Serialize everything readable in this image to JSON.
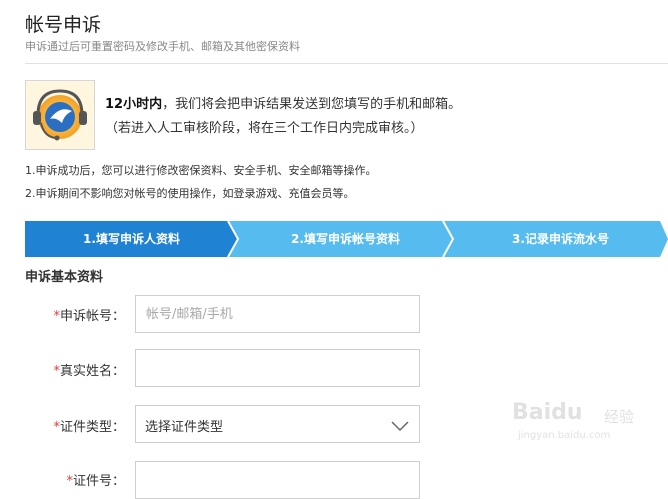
{
  "header": {
    "title": "帐号申诉",
    "subtitle": "申诉通过后可重置密码及修改手机、邮箱及其他密保资料"
  },
  "notice": {
    "emphasis": "12小时内",
    "line1_rest": "，我们将会把申诉结果发送到您填写的手机和邮箱。",
    "line2": "（若进入人工审核阶段，将在三个工作日内完成审核。）",
    "icon": "headset-support-icon"
  },
  "notes": [
    "1.申诉成功后，您可以进行修改密保资料、安全手机、安全邮箱等操作。",
    "2.申诉期间不影响您对帐号的使用操作，如登录游戏、充值会员等。"
  ],
  "steps": [
    {
      "label": "1.填写申诉人资料",
      "active": true
    },
    {
      "label": "2.填写申诉帐号资料",
      "active": false
    },
    {
      "label": "3.记录申诉流水号",
      "active": false
    }
  ],
  "colors": {
    "step_active": "#1f82d3",
    "step_inactive": "#56bbef",
    "required_star": "#e4393c"
  },
  "form": {
    "section_title": "申诉基本资料",
    "fields": [
      {
        "required": "*",
        "label": "申诉帐号：",
        "placeholder": "帐号/邮箱/手机",
        "value": ""
      },
      {
        "required": "*",
        "label": "真实姓名：",
        "placeholder": "",
        "value": ""
      },
      {
        "required": "*",
        "label": "证件类型：",
        "selected": "选择证件类型"
      },
      {
        "required": "*",
        "label": "证件号："
      }
    ]
  },
  "watermark": {
    "brand": "Baidu",
    "sub": "经验",
    "url": "jingyan.baidu.com"
  }
}
